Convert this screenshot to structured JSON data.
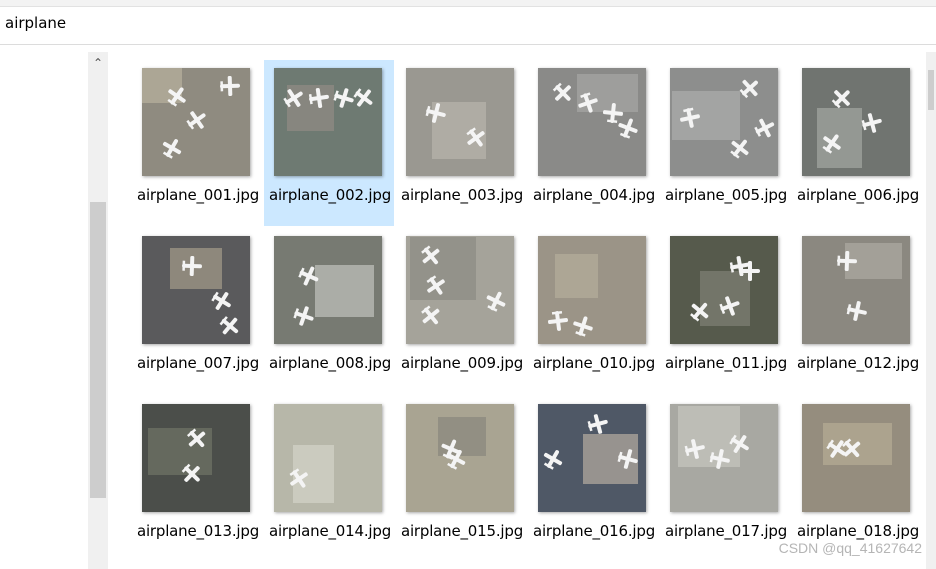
{
  "address_bar": {
    "folder": "airplane"
  },
  "files": [
    {
      "name": "airplane_001.jpg",
      "bg": "#8f8b80",
      "ground": "#b3ac9a"
    },
    {
      "name": "airplane_002.jpg",
      "bg": "#6e7a72",
      "ground": "#8d8a82",
      "selected": true
    },
    {
      "name": "airplane_003.jpg",
      "bg": "#9a9891",
      "ground": "#b4b1a9"
    },
    {
      "name": "airplane_004.jpg",
      "bg": "#8a8a88",
      "ground": "#a3a3a1"
    },
    {
      "name": "airplane_005.jpg",
      "bg": "#8d8e8d",
      "ground": "#a9aaa9"
    },
    {
      "name": "airplane_006.jpg",
      "bg": "#707470",
      "ground": "#9ea19c"
    },
    {
      "name": "airplane_007.jpg",
      "bg": "#5a5a5c",
      "ground": "#9b9485"
    },
    {
      "name": "airplane_008.jpg",
      "bg": "#777a72",
      "ground": "#b8bab4"
    },
    {
      "name": "airplane_009.jpg",
      "bg": "#a5a39a",
      "ground": "#8f8d86"
    },
    {
      "name": "airplane_010.jpg",
      "bg": "#9b9487",
      "ground": "#b2aa98"
    },
    {
      "name": "airplane_011.jpg",
      "bg": "#565a4c",
      "ground": "#7a7c70"
    },
    {
      "name": "airplane_012.jpg",
      "bg": "#8b8880",
      "ground": "#a9a69d"
    },
    {
      "name": "airplane_013.jpg",
      "bg": "#4b4e4a",
      "ground": "#6c7163"
    },
    {
      "name": "airplane_014.jpg",
      "bg": "#b7b7a9",
      "ground": "#cfd0c4"
    },
    {
      "name": "airplane_015.jpg",
      "bg": "#a9a492",
      "ground": "#8c8a80"
    },
    {
      "name": "airplane_016.jpg",
      "bg": "#4f5866",
      "ground": "#a9a39a"
    },
    {
      "name": "airplane_017.jpg",
      "bg": "#a8a8a2",
      "ground": "#c2c2bb"
    },
    {
      "name": "airplane_018.jpg",
      "bg": "#958d7e",
      "ground": "#b1a992"
    }
  ],
  "watermark": "CSDN @qq_41627642"
}
